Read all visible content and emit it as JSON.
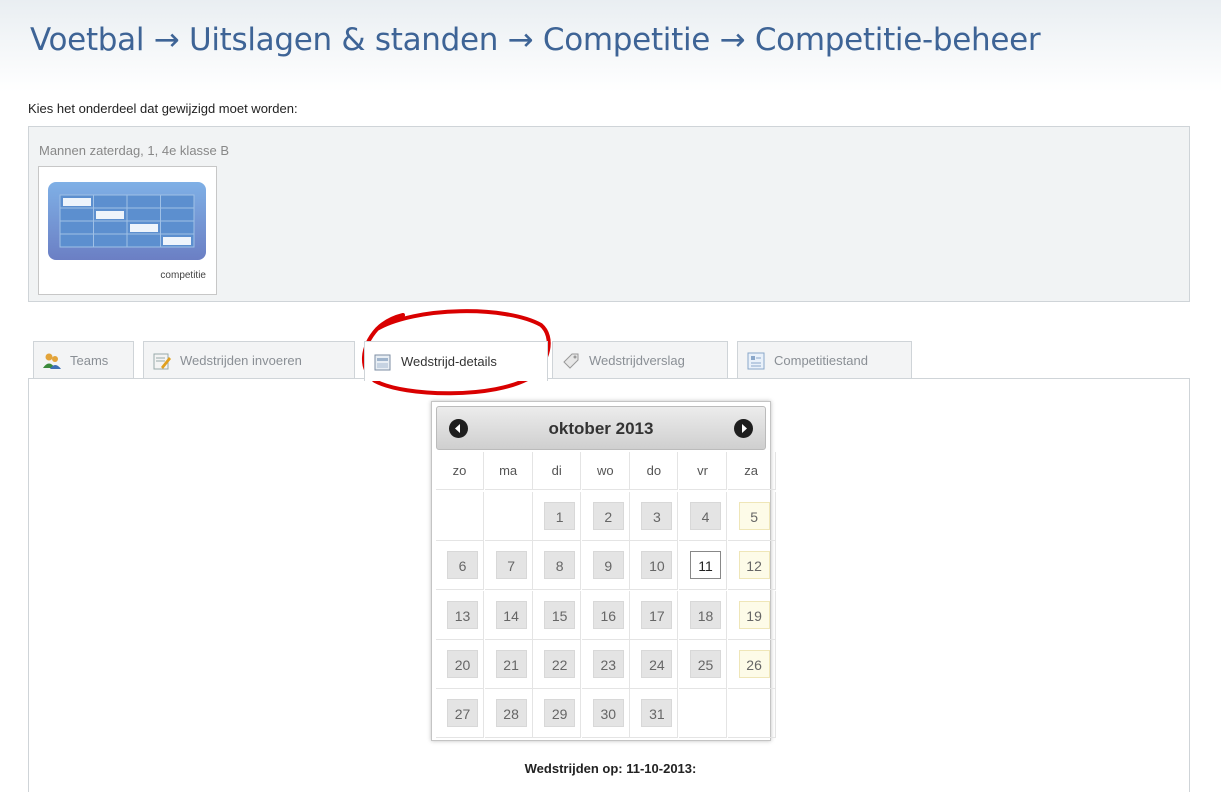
{
  "header": {
    "breadcrumb": "Voetbal → Uitslagen & standen → Competitie → Competitie-beheer"
  },
  "instruction": "Kies het onderdeel dat gewijzigd moet worden:",
  "module_group": {
    "label": "Mannen zaterdag, 1, 4e klasse B",
    "tile_caption": "competitie"
  },
  "tabs": [
    {
      "label": "Teams",
      "icon": "teams-icon"
    },
    {
      "label": "Wedstrijden invoeren",
      "icon": "edit-matches-icon"
    },
    {
      "label": "Wedstrijd-details",
      "icon": "match-details-icon",
      "active": true
    },
    {
      "label": "Wedstrijdverslag",
      "icon": "tag-icon"
    },
    {
      "label": "Competitiestand",
      "icon": "standings-icon"
    }
  ],
  "calendar": {
    "title": "oktober 2013",
    "weekdays": [
      "zo",
      "ma",
      "di",
      "wo",
      "do",
      "vr",
      "za"
    ],
    "weeks": [
      [
        "",
        "",
        "1",
        "2",
        "3",
        "4",
        "5"
      ],
      [
        "6",
        "7",
        "8",
        "9",
        "10",
        "11",
        "12"
      ],
      [
        "13",
        "14",
        "15",
        "16",
        "17",
        "18",
        "19"
      ],
      [
        "20",
        "21",
        "22",
        "23",
        "24",
        "25",
        "26"
      ],
      [
        "27",
        "28",
        "29",
        "30",
        "31",
        "",
        ""
      ]
    ],
    "selected_day": "11"
  },
  "matches_label": "Wedstrijden op: 11-10-2013:",
  "colors": {
    "title": "#3e6496",
    "annotation": "#d90000"
  }
}
